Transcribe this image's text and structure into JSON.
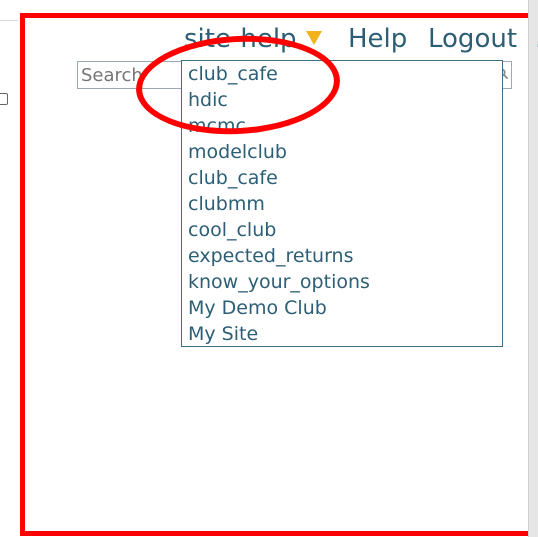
{
  "header": {
    "site_menu_label": "site-help",
    "help_label": "Help",
    "logout_label": "Logout",
    "trailing_char": "."
  },
  "search": {
    "placeholder": "Search"
  },
  "dropdown": {
    "items": [
      {
        "label": "club_cafe"
      },
      {
        "label": "hdic"
      },
      {
        "label": "mcmc"
      },
      {
        "label": "modelclub"
      },
      {
        "label": "club_cafe"
      },
      {
        "label": "clubmm"
      },
      {
        "label": "cool_club"
      },
      {
        "label": "expected_returns"
      },
      {
        "label": "know_your_options"
      },
      {
        "label": "My Demo Club"
      },
      {
        "label": "My Site"
      }
    ]
  },
  "colors": {
    "link": "#2c5f75",
    "triangle": "#f1b319",
    "annotation": "#ff0000",
    "dropdown_border": "#3f6f84"
  },
  "icons": {
    "site_menu_dropdown": "chevron-down-icon",
    "search": "search-icon"
  }
}
